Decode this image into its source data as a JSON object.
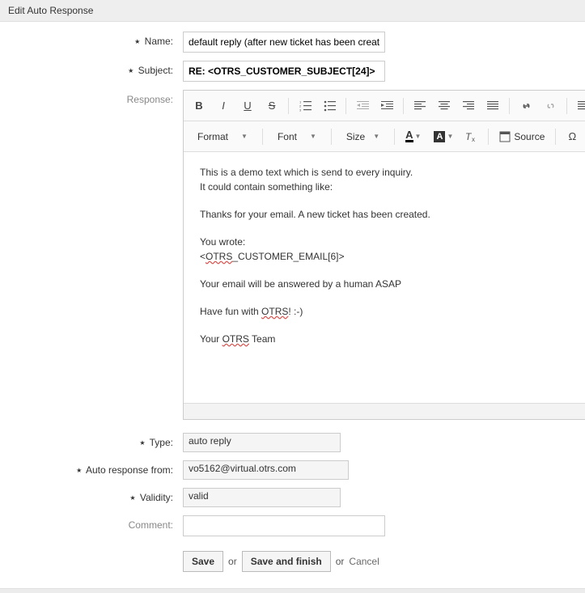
{
  "header": {
    "title": "Edit Auto Response"
  },
  "form": {
    "name": {
      "label": "Name:",
      "value": "default reply (after new ticket has been created)",
      "required": true
    },
    "subject": {
      "label": "Subject:",
      "value": "RE: <OTRS_CUSTOMER_SUBJECT[24]>",
      "required": true
    },
    "response": {
      "label": "Response:",
      "required": false
    },
    "type": {
      "label": "Type:",
      "value": "auto reply",
      "required": true
    },
    "auto_response_from": {
      "label": "Auto response from:",
      "value": "vo5162@virtual.otrs.com",
      "required": true
    },
    "validity": {
      "label": "Validity:",
      "value": "valid",
      "required": true
    },
    "comment": {
      "label": "Comment:",
      "value": "",
      "required": false
    }
  },
  "editor": {
    "toolbar": {
      "format": "Format",
      "font": "Font",
      "size": "Size",
      "source": "Source"
    },
    "body": {
      "l1": "This is a demo text which is send to every inquiry.",
      "l2": "It could contain something like:",
      "l3": "Thanks for your email. A new ticket has been created.",
      "l4": "You wrote:",
      "l5a": "<",
      "l5b": "OTRS",
      "l5c": "_CUSTOMER_EMAIL[6]>",
      "l6": "Your email will be answered by a human ASAP",
      "l7a": "Have fun with ",
      "l7b": "OTRS",
      "l7c": "! :-)",
      "l8a": "Your ",
      "l8b": "OTRS",
      "l8c": " Team"
    }
  },
  "actions": {
    "save": "Save",
    "or1": "or",
    "save_finish": "Save and finish",
    "or2": "or",
    "cancel": "Cancel"
  }
}
